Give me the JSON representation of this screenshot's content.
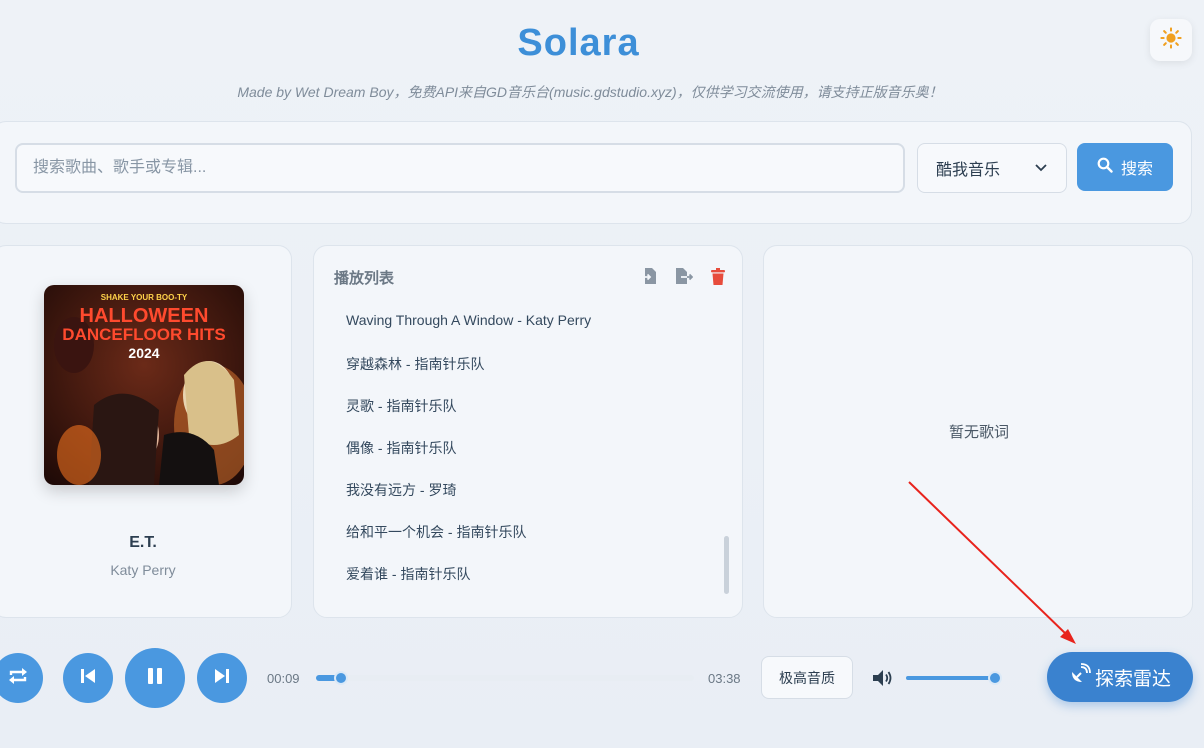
{
  "app": {
    "title": "Solara",
    "subtitle": "Made by Wet Dream Boy，免费API来自GD音乐台(music.gdstudio.xyz)，仅供学习交流使用，请支持正版音乐奥！"
  },
  "search": {
    "placeholder": "搜索歌曲、歌手或专辑...",
    "value": "",
    "source_selected": "酷我音乐",
    "button_label": "搜索"
  },
  "now_playing": {
    "title": "E.T.",
    "artist": "Katy Perry",
    "cover": {
      "line1": "SHAKE YOUR BOO-TY",
      "line2": "HALLOWEEN",
      "line3": "DANCEFLOOR HITS",
      "line4": "2024"
    }
  },
  "playlist": {
    "header": "播放列表",
    "items": [
      "Waving Through A Window - Katy Perry",
      "穿越森林 - 指南针乐队",
      "灵歌 - 指南针乐队",
      "偶像 - 指南针乐队",
      "我没有远方 - 罗琦",
      "给和平一个机会 - 指南针乐队",
      "爱着谁 - 指南针乐队"
    ]
  },
  "lyrics": {
    "empty_text": "暂无歌词"
  },
  "player": {
    "current_time": "00:09",
    "total_time": "03:38",
    "progress_fraction": 0.06,
    "quality_label": "极高音质",
    "volume_fraction": 1.0,
    "radar_label": "探索雷达"
  },
  "colors": {
    "accent": "#4a98e0",
    "delete": "#e74c3c",
    "theme_icon": "#f0a020",
    "annotation_arrow": "#e8231c"
  },
  "icons": {
    "theme": "sun-icon",
    "search": "magnifier-icon",
    "import": "file-import-icon",
    "export": "file-export-icon",
    "clear": "trash-icon",
    "mode": "repeat-icon",
    "prev": "skip-back-icon",
    "play": "pause-icon",
    "next": "skip-forward-icon",
    "volume": "volume-icon",
    "radar": "satellite-dish-icon"
  }
}
